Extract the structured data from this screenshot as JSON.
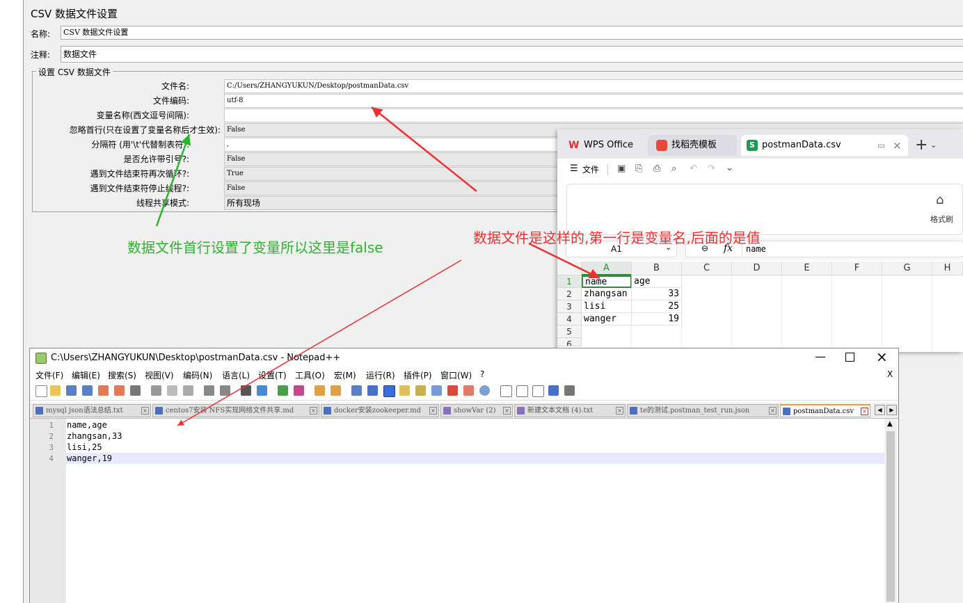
{
  "jmeter": {
    "title": "CSV 数据文件设置",
    "name_label": "名称:",
    "name_value": "CSV 数据文件设置",
    "comment_label": "注释:",
    "comment_value": "数据文件",
    "group_title": "设置 CSV 数据文件",
    "rows": [
      {
        "label": "文件名:",
        "value": "C:/Users/ZHANGYUKUN/Desktop/postmanData.csv"
      },
      {
        "label": "文件编码:",
        "value": "utf-8"
      },
      {
        "label": "变量名称(西文逗号间隔):",
        "value": ""
      },
      {
        "label": "忽略首行(只在设置了变量名称后才生效):",
        "value": "False"
      },
      {
        "label": "分隔符 (用'\\t'代替制表符):",
        "value": ","
      },
      {
        "label": "是否允许带引号?:",
        "value": "False"
      },
      {
        "label": "遇到文件结束符再次循环?:",
        "value": "True"
      },
      {
        "label": "遇到文件结束符停止线程?:",
        "value": "False"
      },
      {
        "label": "线程共享模式:",
        "value": "所有现场"
      }
    ]
  },
  "wps": {
    "tabs": [
      "WPS Office",
      "找稻壳模板",
      "postmanData.csv"
    ],
    "menu_label": "文件",
    "ribbon_button": "格式刷",
    "cell_ref": "A1",
    "fx": "fx",
    "formula_value": "name",
    "columns": [
      "A",
      "B",
      "C",
      "D",
      "E",
      "F",
      "G",
      "H"
    ],
    "rows": [
      "1",
      "2",
      "3",
      "4",
      "5",
      "6"
    ],
    "cells": [
      [
        "name",
        "age"
      ],
      [
        "zhangsan",
        "33"
      ],
      [
        "lisi",
        "25"
      ],
      [
        "wanger",
        "19"
      ]
    ]
  },
  "npp": {
    "title": "C:\\Users\\ZHANGYUKUN\\Desktop\\postmanData.csv - Notepad++",
    "menu": [
      "文件(F)",
      "编辑(E)",
      "搜索(S)",
      "视图(V)",
      "编码(N)",
      "语言(L)",
      "设置(T)",
      "工具(O)",
      "宏(M)",
      "运行(R)",
      "插件(P)",
      "窗口(W)",
      "?"
    ],
    "menu_close": "X",
    "tabs": [
      "mysql json语法总结.txt",
      "centos7安装 NFS实现网络文件共享.md",
      "docker安装zookeeper.md",
      "showVar (2)",
      "新建文本文档 (4).txt",
      "te的测试.postman_test_run.json",
      "postmanData.csv"
    ],
    "line_numbers": [
      "1",
      "2",
      "3",
      "4"
    ],
    "lines": [
      "name,age",
      "zhangsan,33",
      "lisi,25",
      "wanger,19"
    ]
  },
  "annotations": {
    "green": "数据文件首行设置了变量所以这里是false",
    "red": "数据文件是这样的,第一行是变量名,后面的是值"
  },
  "colors": {
    "green": "#2bb52b",
    "red": "#f03030",
    "wps_green": "#2e8b3a",
    "npp_highlight": "#e8e8ff"
  }
}
